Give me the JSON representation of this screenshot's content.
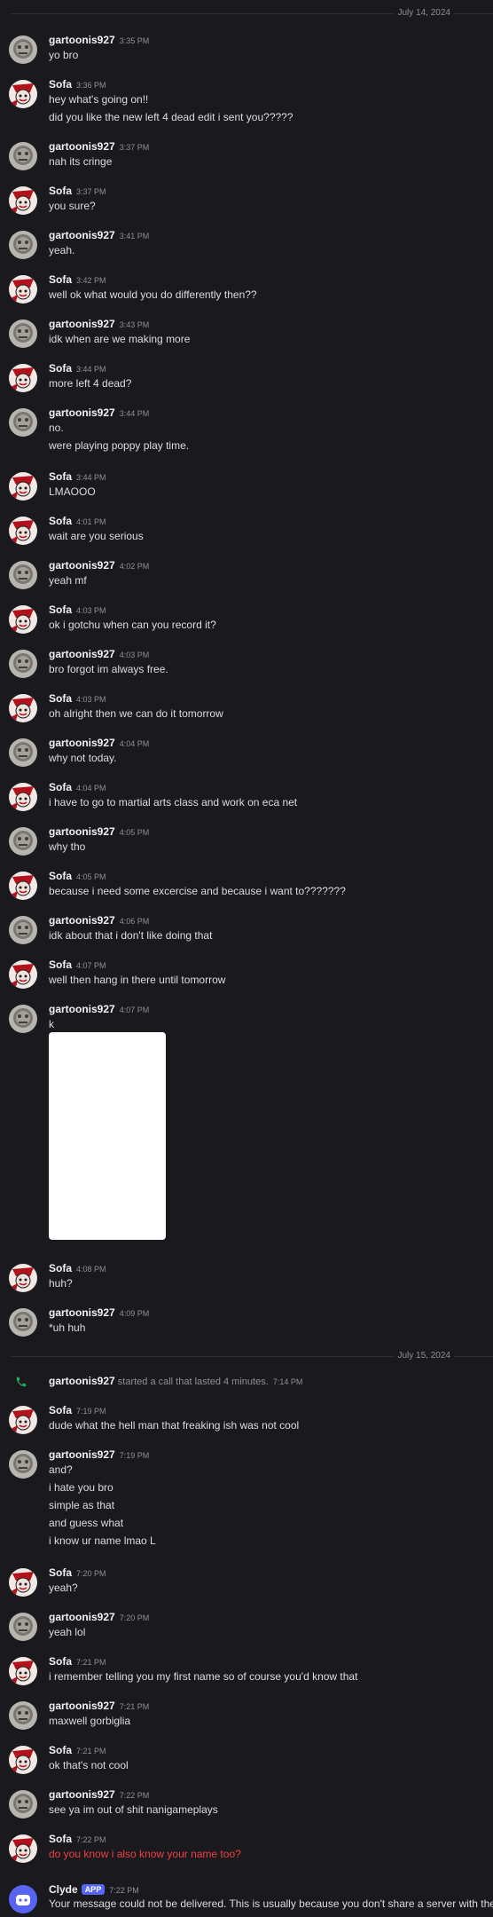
{
  "dividers": [
    "July 14, 2024",
    "July 15, 2024"
  ],
  "users": {
    "g": "gartoonis927",
    "s": "Sofa",
    "c": "Clyde"
  },
  "app_badge": "APP",
  "messages": [
    {
      "u": "g",
      "time": "3:35 PM",
      "lines": [
        "yo bro"
      ]
    },
    {
      "u": "s",
      "time": "3:36 PM",
      "lines": [
        "hey what's going on!!",
        "did you like the new left 4 dead edit i sent you?????"
      ]
    },
    {
      "u": "g",
      "time": "3:37 PM",
      "lines": [
        "nah its cringe"
      ]
    },
    {
      "u": "s",
      "time": "3:37 PM",
      "lines": [
        "you sure?"
      ]
    },
    {
      "u": "g",
      "time": "3:41 PM",
      "lines": [
        "yeah."
      ]
    },
    {
      "u": "s",
      "time": "3:42 PM",
      "lines": [
        "well ok what would you do differently then??"
      ]
    },
    {
      "u": "g",
      "time": "3:43 PM",
      "lines": [
        "idk when are we making more"
      ]
    },
    {
      "u": "s",
      "time": "3:44 PM",
      "lines": [
        "more left 4 dead?"
      ]
    },
    {
      "u": "g",
      "time": "3:44 PM",
      "lines": [
        "no.",
        "were playing poppy play time."
      ]
    },
    {
      "u": "s",
      "time": "3:44 PM",
      "lines": [
        "LMAOOO"
      ]
    },
    {
      "u": "s",
      "time": "4:01 PM",
      "lines": [
        "wait are you serious"
      ]
    },
    {
      "u": "g",
      "time": "4:02 PM",
      "lines": [
        "yeah mf"
      ]
    },
    {
      "u": "s",
      "time": "4:03 PM",
      "lines": [
        "ok i gotchu when can you record it?"
      ]
    },
    {
      "u": "g",
      "time": "4:03 PM",
      "lines": [
        "bro forgot im always free."
      ]
    },
    {
      "u": "s",
      "time": "4:03 PM",
      "lines": [
        "oh alright then we can do it tomorrow"
      ]
    },
    {
      "u": "g",
      "time": "4:04 PM",
      "lines": [
        "why not today."
      ]
    },
    {
      "u": "s",
      "time": "4:04 PM",
      "lines": [
        "i have to go to martial arts class and work on eca net"
      ]
    },
    {
      "u": "g",
      "time": "4:05 PM",
      "lines": [
        "why tho"
      ]
    },
    {
      "u": "s",
      "time": "4:05 PM",
      "lines": [
        "because i need some excercise and because i want to???????"
      ]
    },
    {
      "u": "g",
      "time": "4:06 PM",
      "lines": [
        "idk about that i don't like doing that"
      ]
    },
    {
      "u": "s",
      "time": "4:07 PM",
      "lines": [
        "well then hang in there until tomorrow"
      ]
    },
    {
      "u": "g",
      "time": "4:07 PM",
      "lines": [
        "k"
      ],
      "attachment": true
    },
    {
      "u": "s",
      "time": "4:08 PM",
      "lines": [
        "huh?"
      ]
    },
    {
      "u": "g",
      "time": "4:09 PM",
      "lines": [
        "*uh huh"
      ]
    },
    {
      "u": "s",
      "time": "7:19 PM",
      "lines": [
        "dude what the hell man that freaking ish was not cool"
      ]
    },
    {
      "u": "g",
      "time": "7:19 PM",
      "lines": [
        "and?",
        "i hate you bro",
        "simple as that",
        "and guess what",
        "i know ur name lmao L"
      ]
    },
    {
      "u": "s",
      "time": "7:20 PM",
      "lines": [
        "yeah?"
      ]
    },
    {
      "u": "g",
      "time": "7:20 PM",
      "lines": [
        "yeah lol"
      ]
    },
    {
      "u": "s",
      "time": "7:21 PM",
      "lines": [
        "i remember telling you my first name so of course you'd know that"
      ]
    },
    {
      "u": "g",
      "time": "7:21 PM",
      "lines": [
        "maxwell gorbiglia"
      ]
    },
    {
      "u": "s",
      "time": "7:21 PM",
      "lines": [
        "ok that's not cool"
      ]
    },
    {
      "u": "g",
      "time": "7:22 PM",
      "lines": [
        "see ya im out of shit nanigameplays"
      ]
    },
    {
      "u": "s",
      "time": "7:22 PM",
      "lines": [
        "do you know i also know your name too?"
      ],
      "failed": true
    },
    {
      "u": "c",
      "time": "7:22 PM",
      "lines": [
        "Your message could not be delivered. This is usually because you don't share a server with the r"
      ]
    }
  ],
  "call": {
    "user": "gartoonis927",
    "text": "started a call that lasted 4 minutes.",
    "time": "7:14 PM"
  },
  "colors": {
    "background": "#1a1a1e",
    "failed_text": "#f23f43",
    "app_badge": "#5865f2",
    "call_icon": "#23a55a"
  }
}
